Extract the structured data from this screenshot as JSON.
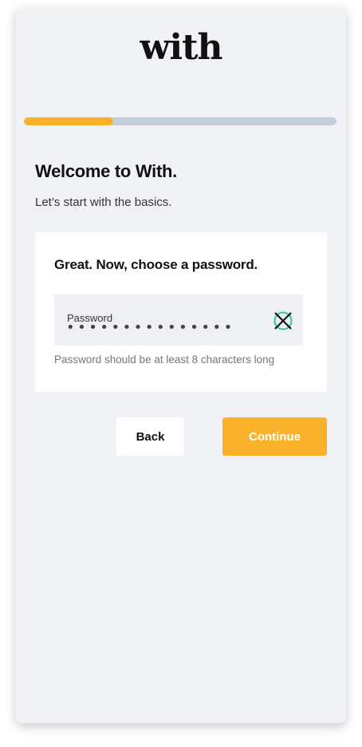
{
  "brand": {
    "logo_text": "with"
  },
  "progress": {
    "fraction": 0.285,
    "fill_color": "#fbb22b",
    "track_color": "#c4cfdc"
  },
  "welcome": {
    "title": "Welcome to With.",
    "subtitle": "Let’s start with the basics."
  },
  "form": {
    "heading": "Great. Now, choose a password.",
    "password_field": {
      "label": "Password",
      "masked_value": "•••••••••••••••",
      "toggle_icon": "visibility-toggle-icon"
    },
    "hint": "Password should be at least 8 characters long"
  },
  "actions": {
    "back_label": "Back",
    "continue_label": "Continue",
    "accent_color": "#fbb22b"
  }
}
